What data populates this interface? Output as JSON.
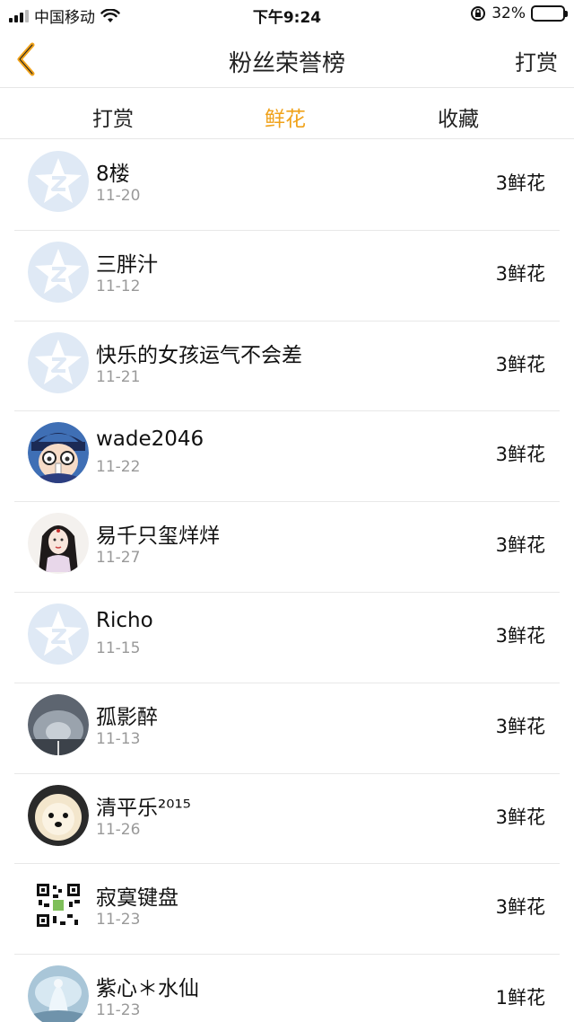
{
  "status_bar": {
    "carrier": "中国移动",
    "time": "下午9:24",
    "battery_percent": "32%",
    "battery_level": 0.32
  },
  "nav": {
    "title": "粉丝荣誉榜",
    "action": "打赏"
  },
  "tabs": [
    {
      "label": "打赏",
      "active": false
    },
    {
      "label": "鲜花",
      "active": true
    },
    {
      "label": "收藏",
      "active": false
    }
  ],
  "accent_color": "#f0a21a",
  "rows": [
    {
      "name": "8楼",
      "date": "11-20",
      "amount": "3鲜花",
      "avatar": "default-avatar-icon"
    },
    {
      "name": "三胖汁",
      "date": "11-12",
      "amount": "3鲜花",
      "avatar": "default-avatar-icon"
    },
    {
      "name": "快乐的女孩运气不会差",
      "date": "11-21",
      "amount": "3鲜花",
      "avatar": "default-avatar-icon"
    },
    {
      "name": "wade2046",
      "date": "11-22",
      "amount": "3鲜花",
      "avatar": "cartoon-boy-avatar"
    },
    {
      "name": "易千只玺烊烊",
      "date": "11-27",
      "amount": "3鲜花",
      "avatar": "girl-portrait-avatar"
    },
    {
      "name": "Richo",
      "date": "11-15",
      "amount": "3鲜花",
      "avatar": "default-avatar-icon"
    },
    {
      "name": "孤影醉",
      "date": "11-13",
      "amount": "3鲜花",
      "avatar": "tunnel-photo-avatar"
    },
    {
      "name": "清平乐²⁰¹⁵",
      "date": "11-26",
      "amount": "3鲜花",
      "avatar": "puppy-photo-avatar"
    },
    {
      "name": "寂寞键盘",
      "date": "11-23",
      "amount": "3鲜花",
      "avatar": "qr-code-avatar"
    },
    {
      "name": "紫心＊水仙",
      "date": "11-23",
      "amount": "1鲜花",
      "avatar": "fantasy-figure-avatar"
    }
  ]
}
